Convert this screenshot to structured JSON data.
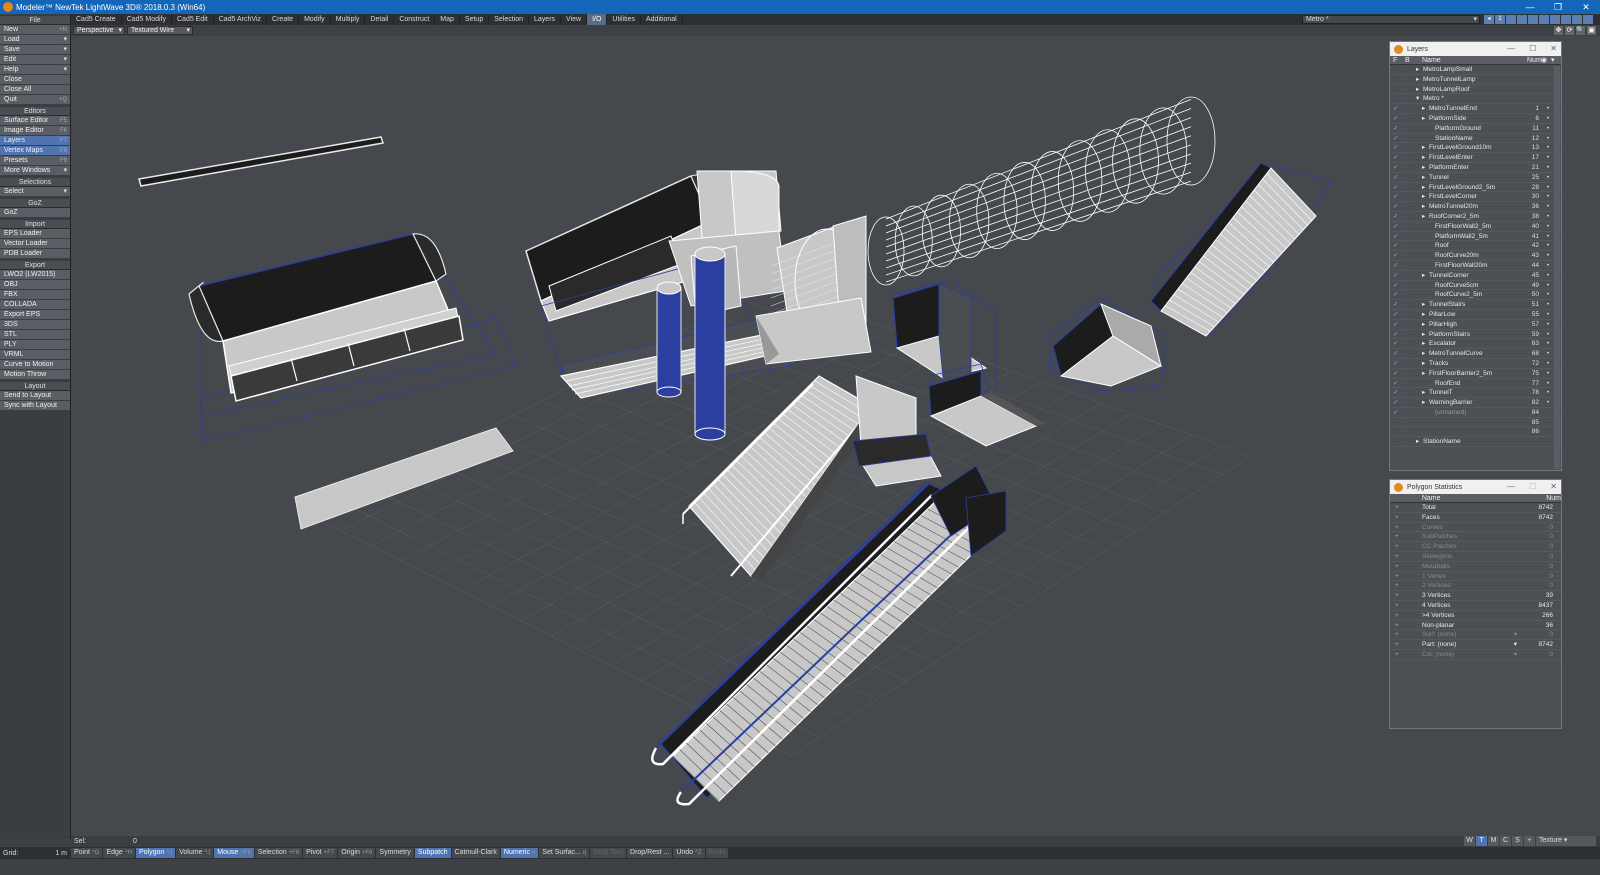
{
  "window": {
    "title": "Modeler™ NewTek LightWave 3D® 2018.0.3 (Win64)",
    "controls": [
      "—",
      "❐",
      "✕"
    ]
  },
  "tabs": [
    {
      "label": "Cad5 Create",
      "active": false
    },
    {
      "label": "Cad5 Modify",
      "active": false
    },
    {
      "label": "Cad5 Edit",
      "active": false
    },
    {
      "label": "Cad5 ArchViz",
      "active": false
    },
    {
      "label": "Create",
      "active": false
    },
    {
      "label": "Modify",
      "active": false
    },
    {
      "label": "Multiply",
      "active": false
    },
    {
      "label": "Detail",
      "active": false
    },
    {
      "label": "Construct",
      "active": false
    },
    {
      "label": "Map",
      "active": false
    },
    {
      "label": "Setup",
      "active": false
    },
    {
      "label": "Selection",
      "active": false
    },
    {
      "label": "Layers",
      "active": false
    },
    {
      "label": "View",
      "active": false
    },
    {
      "label": "I/O",
      "active": true
    },
    {
      "label": "Utilities",
      "active": false
    },
    {
      "label": "Additional",
      "active": false
    }
  ],
  "object_select": {
    "value": "Metro *"
  },
  "layer_bank": {
    "number": "1"
  },
  "toolbar": {
    "sections": [
      {
        "header": "File",
        "items": [
          {
            "label": "New",
            "key": "+N"
          },
          {
            "label": "Load",
            "dd": "▾"
          },
          {
            "label": "Save",
            "dd": "▾"
          },
          {
            "label": "Edit",
            "dd": "▾"
          },
          {
            "label": "Help",
            "dd": "▾"
          },
          {
            "label": "Close",
            "key": ""
          },
          {
            "label": "Close All",
            "key": ""
          },
          {
            "label": "Quit",
            "key": "+Q"
          }
        ]
      },
      {
        "header": "Editors",
        "items": [
          {
            "label": "Surface Editor",
            "key": "F5"
          },
          {
            "label": "Image Editor",
            "key": "F6"
          },
          {
            "label": "Layers",
            "key": "F7",
            "sel": true
          },
          {
            "label": "Vertex Maps",
            "key": "F8",
            "sel": true
          },
          {
            "label": "Presets",
            "key": "F9"
          },
          {
            "label": "More Windows",
            "dd": "▾"
          }
        ]
      },
      {
        "header": "Selections",
        "items": [
          {
            "label": "Select",
            "dd": "▾"
          }
        ]
      },
      {
        "header": "GoZ",
        "items": [
          {
            "label": "GoZ",
            "key": ""
          }
        ]
      },
      {
        "header": "Import",
        "items": [
          {
            "label": "EPS Loader",
            "key": ""
          },
          {
            "label": "Vector Loader",
            "key": ""
          },
          {
            "label": "PDB Loader",
            "key": ""
          }
        ]
      },
      {
        "header": "Export",
        "items": [
          {
            "label": "LWO2 (LW2015)",
            "key": ""
          },
          {
            "label": "OBJ",
            "key": ""
          },
          {
            "label": "FBX",
            "key": ""
          },
          {
            "label": "COLLADA",
            "key": ""
          },
          {
            "label": "Export EPS",
            "key": ""
          },
          {
            "label": "3DS",
            "key": ""
          },
          {
            "label": "STL",
            "key": ""
          },
          {
            "label": "PLY",
            "key": ""
          },
          {
            "label": "VRML",
            "key": ""
          },
          {
            "label": "Curve to Motion",
            "key": ""
          },
          {
            "label": "Motion Throw",
            "key": ""
          }
        ]
      },
      {
        "header": "Layout",
        "items": [
          {
            "label": "Send to Layout",
            "key": ""
          },
          {
            "label": "Sync with Layout",
            "key": ""
          }
        ]
      }
    ]
  },
  "viewport": {
    "view": "Perspective",
    "shading": "Textured Wire",
    "icons": [
      "✥",
      "⟳",
      "🔍",
      "▣"
    ]
  },
  "layers_panel": {
    "title": "Layers",
    "columns": {
      "f": "F",
      "b": "B",
      "name": "Name",
      "num": "Num"
    },
    "rows": [
      {
        "name": "MetroLampSmall",
        "num": "",
        "indent": 1,
        "check": "",
        "mark": "",
        "arrow": "▸"
      },
      {
        "name": "MetroTunnelLamp",
        "num": "",
        "indent": 1,
        "check": "",
        "mark": "",
        "arrow": "▸"
      },
      {
        "name": "MetroLampRoof",
        "num": "",
        "indent": 1,
        "check": "",
        "mark": "",
        "arrow": "▸"
      },
      {
        "name": "Metro *",
        "num": "",
        "indent": 1,
        "check": "",
        "mark": "",
        "arrow": "▾"
      },
      {
        "name": "MetroTunnelEnd",
        "num": "1",
        "indent": 2,
        "check": "✓",
        "mark": "•",
        "arrow": "▸"
      },
      {
        "name": "PlatformSide",
        "num": "6",
        "indent": 2,
        "check": "✓",
        "mark": "•",
        "arrow": "▸"
      },
      {
        "name": "PlatformGround",
        "num": "11",
        "indent": 3,
        "check": "✓",
        "mark": "•",
        "arrow": ""
      },
      {
        "name": "StationName",
        "num": "12",
        "indent": 3,
        "check": "✓",
        "mark": "•",
        "arrow": ""
      },
      {
        "name": "FirstLevelGround10m",
        "num": "13",
        "indent": 2,
        "check": "✓",
        "mark": "•",
        "arrow": "▸"
      },
      {
        "name": "FirstLevelEnter",
        "num": "17",
        "indent": 2,
        "check": "✓",
        "mark": "•",
        "arrow": "▸"
      },
      {
        "name": "PlatformEnter",
        "num": "21",
        "indent": 2,
        "check": "✓",
        "mark": "•",
        "arrow": "▸"
      },
      {
        "name": "Tunnel",
        "num": "25",
        "indent": 2,
        "check": "✓",
        "mark": "•",
        "arrow": "▸"
      },
      {
        "name": "FirstLevelGround2_5m",
        "num": "28",
        "indent": 2,
        "check": "✓",
        "mark": "•",
        "arrow": "▸"
      },
      {
        "name": "FirstLevelCorner",
        "num": "30",
        "indent": 2,
        "check": "✓",
        "mark": "•",
        "arrow": "▸"
      },
      {
        "name": "MetroTunnel20m",
        "num": "36",
        "indent": 2,
        "check": "✓",
        "mark": "•",
        "arrow": "▸"
      },
      {
        "name": "RoofCorner2_5m",
        "num": "38",
        "indent": 2,
        "check": "✓",
        "mark": "•",
        "arrow": "▸"
      },
      {
        "name": "FirstFloorWall2_5m",
        "num": "40",
        "indent": 3,
        "check": "✓",
        "mark": "•",
        "arrow": ""
      },
      {
        "name": "PlatformWall2_5m",
        "num": "41",
        "indent": 3,
        "check": "✓",
        "mark": "•",
        "arrow": ""
      },
      {
        "name": "Roof",
        "num": "42",
        "indent": 3,
        "check": "✓",
        "mark": "•",
        "arrow": ""
      },
      {
        "name": "RoofCurve20m",
        "num": "43",
        "indent": 3,
        "check": "✓",
        "mark": "•",
        "arrow": ""
      },
      {
        "name": "FirstFloorWall20m",
        "num": "44",
        "indent": 3,
        "check": "✓",
        "mark": "•",
        "arrow": ""
      },
      {
        "name": "TunnelCorner",
        "num": "45",
        "indent": 2,
        "check": "✓",
        "mark": "•",
        "arrow": "▸"
      },
      {
        "name": "RoofCurve5cm",
        "num": "49",
        "indent": 3,
        "check": "✓",
        "mark": "•",
        "arrow": ""
      },
      {
        "name": "RoofCurve2_5m",
        "num": "50",
        "indent": 3,
        "check": "✓",
        "mark": "•",
        "arrow": ""
      },
      {
        "name": "TunnelStairs",
        "num": "51",
        "indent": 2,
        "check": "✓",
        "mark": "•",
        "arrow": "▸"
      },
      {
        "name": "PillarLow",
        "num": "55",
        "indent": 2,
        "check": "✓",
        "mark": "•",
        "arrow": "▸"
      },
      {
        "name": "PillarHigh",
        "num": "57",
        "indent": 2,
        "check": "✓",
        "mark": "•",
        "arrow": "▸"
      },
      {
        "name": "PlatformStairs",
        "num": "59",
        "indent": 2,
        "check": "✓",
        "mark": "•",
        "arrow": "▸"
      },
      {
        "name": "Escalator",
        "num": "63",
        "indent": 2,
        "check": "✓",
        "mark": "•",
        "arrow": "▸"
      },
      {
        "name": "MetroTunnelCurve",
        "num": "68",
        "indent": 2,
        "check": "✓",
        "mark": "•",
        "arrow": "▸"
      },
      {
        "name": "Tracks",
        "num": "72",
        "indent": 2,
        "check": "✓",
        "mark": "•",
        "arrow": "▸"
      },
      {
        "name": "FirstFloorBarrier2_5m",
        "num": "75",
        "indent": 2,
        "check": "✓",
        "mark": "•",
        "arrow": "▸"
      },
      {
        "name": "RoofEnd",
        "num": "77",
        "indent": 3,
        "check": "✓",
        "mark": "•",
        "arrow": ""
      },
      {
        "name": "TunnelT",
        "num": "78",
        "indent": 2,
        "check": "✓",
        "mark": "•",
        "arrow": "▸"
      },
      {
        "name": "WarningBarrier",
        "num": "82",
        "indent": 2,
        "check": "✓",
        "mark": "•",
        "arrow": "▸"
      },
      {
        "name": "(unnamed)",
        "num": "84",
        "indent": 3,
        "check": "✓",
        "mark": "",
        "arrow": "",
        "dim": true
      },
      {
        "name": "",
        "num": "85",
        "indent": 3,
        "check": "",
        "mark": "",
        "arrow": "",
        "dim": true
      },
      {
        "name": "",
        "num": "86",
        "indent": 3,
        "check": "",
        "mark": "",
        "arrow": "",
        "dim": true
      },
      {
        "name": "StationName",
        "num": "",
        "indent": 1,
        "check": "",
        "mark": "",
        "arrow": "▸"
      }
    ]
  },
  "stats_panel": {
    "title": "Polygon Statistics",
    "columns": {
      "name": "Name",
      "num": "Num"
    },
    "rows": [
      {
        "name": "Total",
        "num": "8742",
        "dim": false
      },
      {
        "name": "Faces",
        "num": "8742",
        "dim": false
      },
      {
        "name": "Curves",
        "num": "0",
        "dim": true
      },
      {
        "name": "SubPatches",
        "num": "0",
        "dim": true
      },
      {
        "name": "CC Patches",
        "num": "0",
        "dim": true
      },
      {
        "name": "Skelegons",
        "num": "0",
        "dim": true
      },
      {
        "name": "Metaballs",
        "num": "0",
        "dim": true
      },
      {
        "name": "1 Vertex",
        "num": "0",
        "dim": true
      },
      {
        "name": "2 Vertices",
        "num": "0",
        "dim": true
      },
      {
        "name": "3 Vertices",
        "num": "39",
        "dim": false
      },
      {
        "name": "4 Vertices",
        "num": "8437",
        "dim": false
      },
      {
        "name": ">4 Vertices",
        "num": "266",
        "dim": false
      },
      {
        "name": "Non-planar",
        "num": "36",
        "dim": false
      },
      {
        "name": "Surf: (none)",
        "num": "0",
        "dim": true,
        "dd": "▾"
      },
      {
        "name": "Part: (none)",
        "num": "8742",
        "dim": false,
        "dd": "▾"
      },
      {
        "name": "Col: (none)",
        "num": "0",
        "dim": true,
        "dd": "▾"
      }
    ]
  },
  "selbar": {
    "label": "Sel:",
    "value": "0"
  },
  "view_buttons": [
    {
      "label": "W",
      "on": false
    },
    {
      "label": "T",
      "on": true
    },
    {
      "label": "M",
      "on": false
    },
    {
      "label": "C",
      "on": false
    },
    {
      "label": "S",
      "on": false
    },
    {
      "label": "+",
      "on": false
    },
    {
      "label": "Texture ▾",
      "on": false,
      "tex": true
    }
  ],
  "bottom": {
    "grid_label": "Grid:",
    "grid_value": "1 m",
    "buttons": [
      {
        "label": "Point",
        "key": "^G",
        "on": false
      },
      {
        "label": "Edge",
        "key": "^H",
        "on": false
      },
      {
        "label": "Polygon",
        "key": "^J",
        "on": true
      },
      {
        "label": "Volume",
        "key": "^J",
        "on": false
      },
      {
        "label": "Mouse",
        "key": "+F8",
        "on": true
      },
      {
        "label": "Selection",
        "key": "+F8",
        "on": false
      },
      {
        "label": "Pivot",
        "key": "+F7",
        "on": false
      },
      {
        "label": "Origin",
        "key": "+F6",
        "on": false
      },
      {
        "label": "Symmetry",
        "key": "",
        "on": false
      },
      {
        "label": "Subpatch",
        "key": "",
        "on": true
      },
      {
        "label": "Catmull-Clark",
        "key": "",
        "on": false
      },
      {
        "label": "Numeric",
        "key": "n",
        "on": true
      },
      {
        "label": "Set Surfac...",
        "key": "q",
        "on": false
      },
      {
        "label": "Drop Tool",
        "key": "",
        "on": false,
        "disabled": true
      },
      {
        "label": "Drop/Rest ...",
        "key": "",
        "on": false
      },
      {
        "label": "Undo",
        "key": "^Z",
        "on": false
      },
      {
        "label": "Redo",
        "key": "",
        "on": false,
        "disabled": true
      }
    ]
  },
  "colors": {
    "titlebar": "#1466b8",
    "accent": "#4f74b0",
    "viewport_bg": "#45484d",
    "grid": "#55595f",
    "wire_blue": "#2a3fa0",
    "solid_light": "#c8c8c8",
    "solid_dark": "#1c1c1c"
  }
}
